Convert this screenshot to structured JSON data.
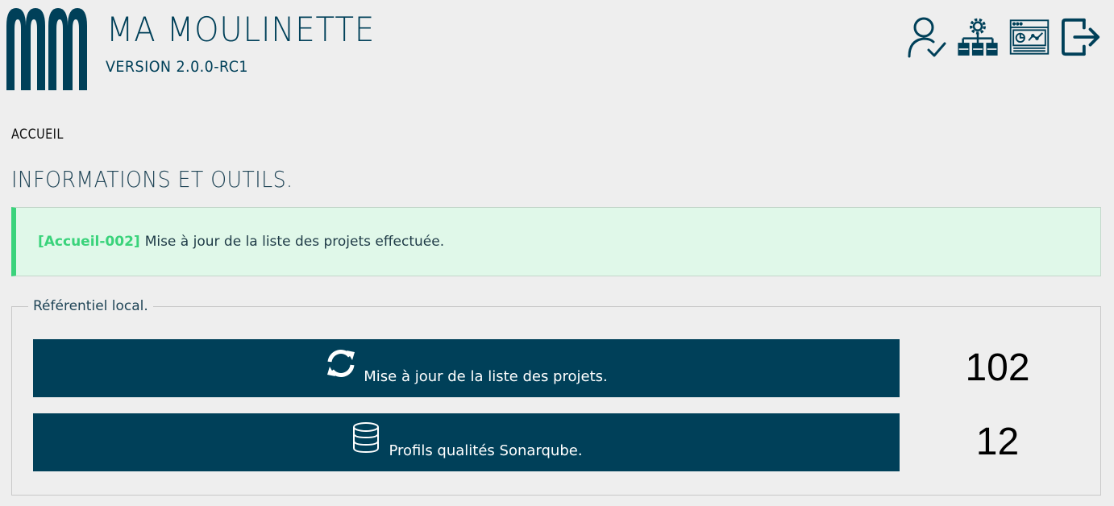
{
  "app": {
    "title": "MA MOULINETTE",
    "version": "VERSION 2.0.0-RC1",
    "logo_icon": "mm-logo-icon"
  },
  "header_icons": [
    {
      "name": "user-check-icon"
    },
    {
      "name": "settings-network-icon"
    },
    {
      "name": "dashboard-icon"
    },
    {
      "name": "logout-icon"
    }
  ],
  "breadcrumb": "ACCUEIL",
  "page_title": "INFORMATIONS ET OUTILS.",
  "alert": {
    "code": "[Accueil-002]",
    "message": "Mise à jour de la liste des projets effectuée."
  },
  "local_repo": {
    "legend": "Référentiel local.",
    "actions": [
      {
        "label": "Mise à jour de la liste des projets.",
        "icon": "refresh-icon",
        "count": "102"
      },
      {
        "label": "Profils qualités Sonarqube.",
        "icon": "database-icon",
        "count": "12"
      }
    ]
  },
  "colors": {
    "primary": "#004059",
    "success": "#3ad37b",
    "alert_bg": "#e0f8e9",
    "background": "#eeeeee"
  }
}
